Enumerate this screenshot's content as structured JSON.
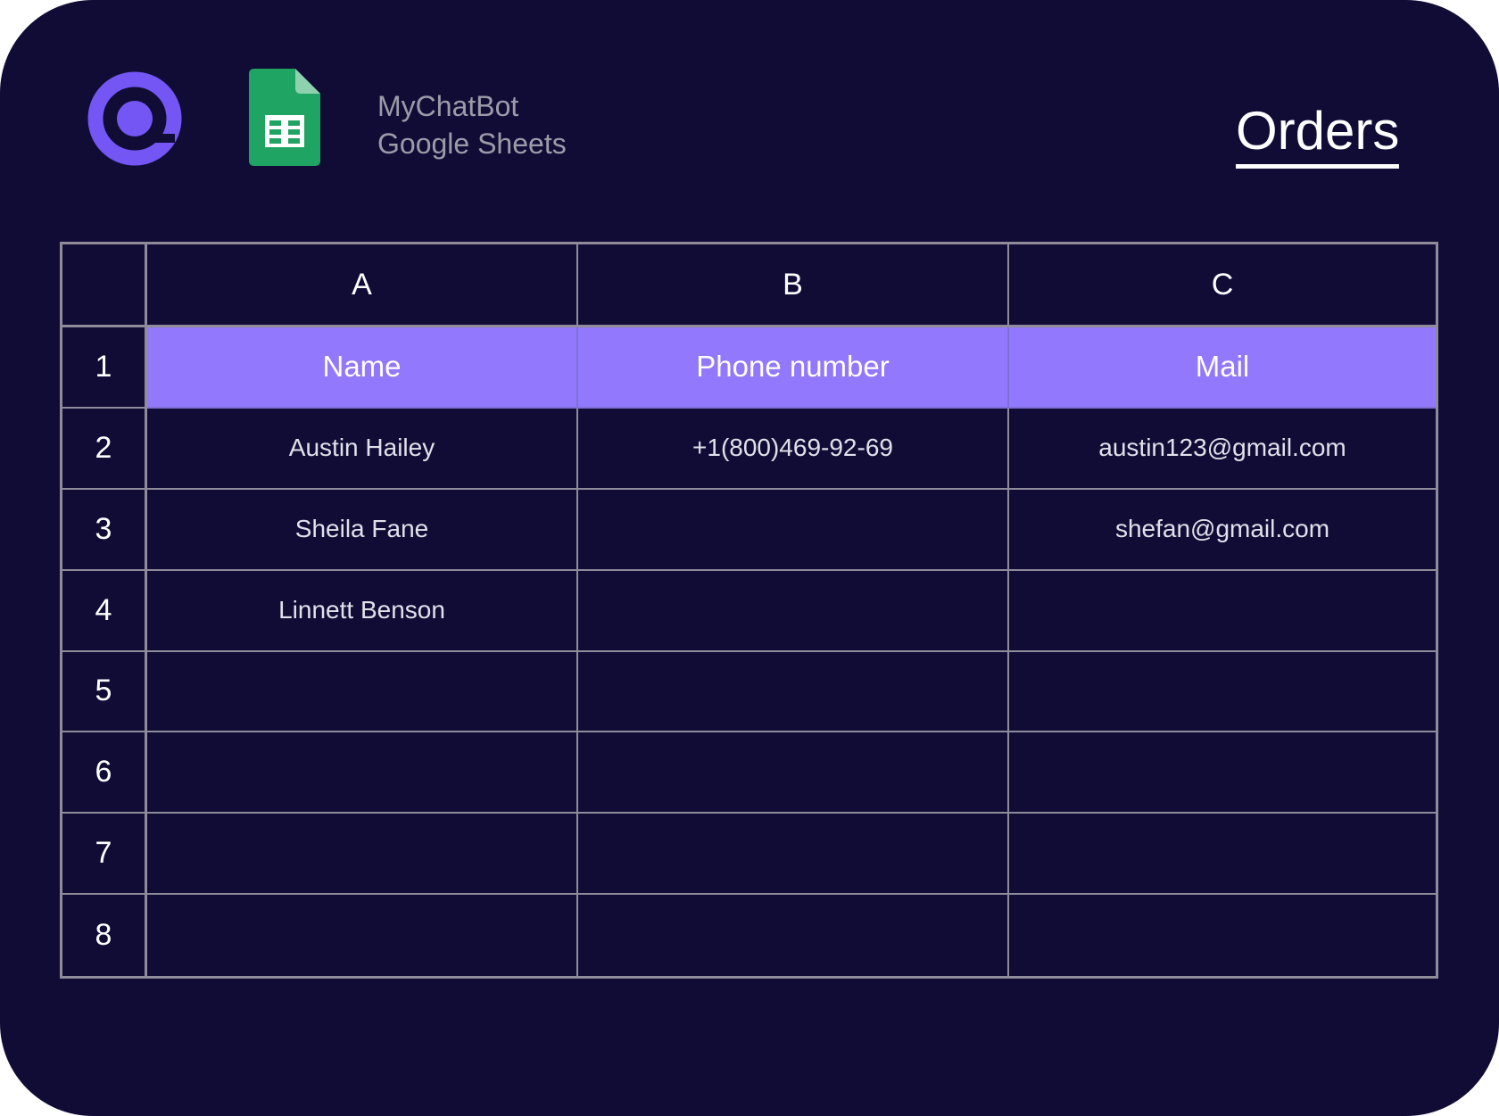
{
  "brand": {
    "line1": "MyChatBot",
    "line2": "Google Sheets",
    "logo_icon": "chat-bubble-logo-icon",
    "sheets_icon": "google-sheets-icon"
  },
  "title": "Orders",
  "colors": {
    "background": "#110c36",
    "header_row": "#9278fc",
    "logo": "#7356f4",
    "sheets_green": "#1fa463"
  },
  "sheet": {
    "columns": [
      "A",
      "B",
      "C"
    ],
    "rows": [
      {
        "num": "1",
        "cells": [
          "Name",
          "Phone number",
          "Mail"
        ]
      },
      {
        "num": "2",
        "cells": [
          "Austin Hailey",
          "+1(800)469-92-69",
          "austin123@gmail.com"
        ]
      },
      {
        "num": "3",
        "cells": [
          "Sheila Fane",
          "",
          "shefan@gmail.com"
        ]
      },
      {
        "num": "4",
        "cells": [
          "Linnett Benson",
          "",
          ""
        ]
      },
      {
        "num": "5",
        "cells": [
          "",
          "",
          ""
        ]
      },
      {
        "num": "6",
        "cells": [
          "",
          "",
          ""
        ]
      },
      {
        "num": "7",
        "cells": [
          "",
          "",
          ""
        ]
      },
      {
        "num": "8",
        "cells": [
          "",
          "",
          ""
        ]
      }
    ]
  }
}
